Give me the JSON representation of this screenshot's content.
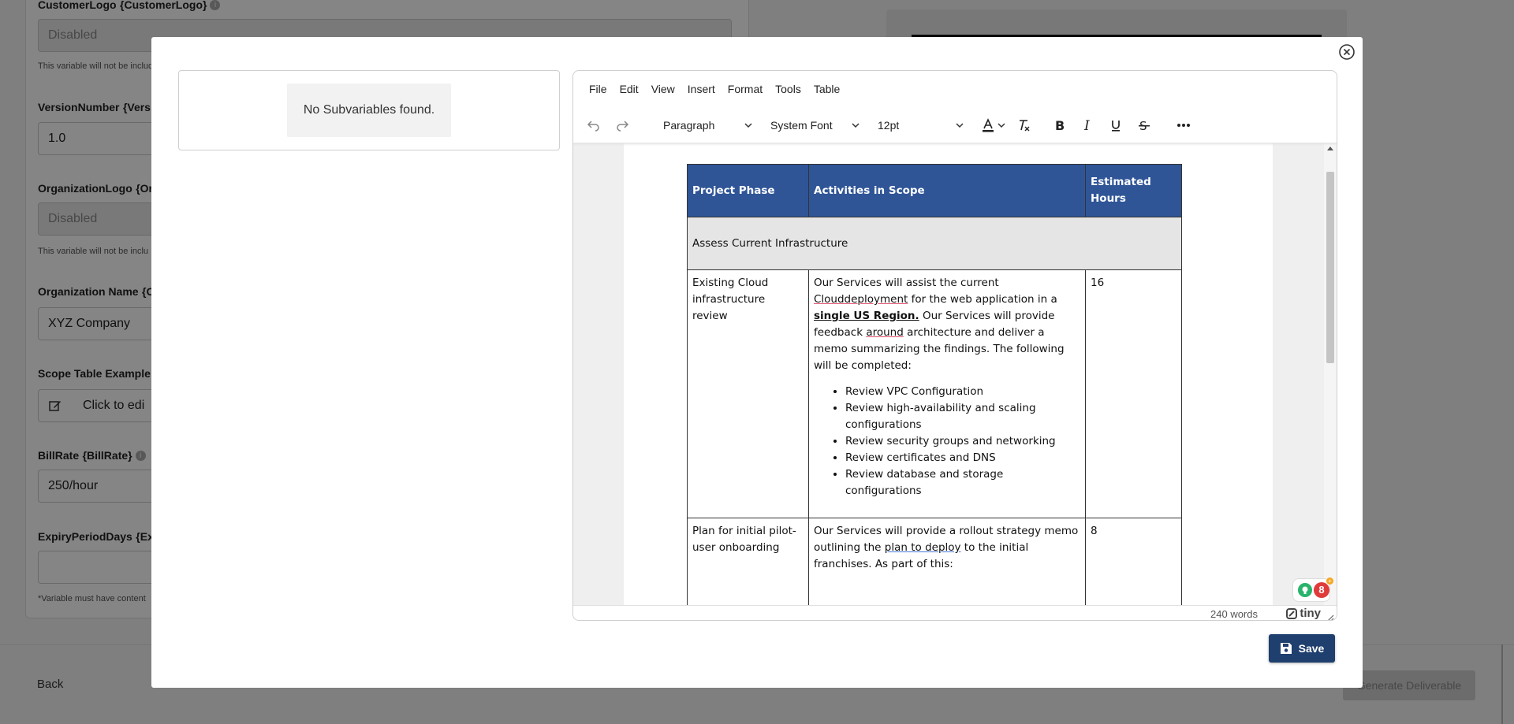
{
  "background": {
    "fields": [
      {
        "label": "CustomerLogo",
        "var": "{CustomerLogo}",
        "value": "Disabled",
        "hint": "This variable will not be included"
      },
      {
        "label": "VersionNumber",
        "var": "{Versio",
        "value": "1.0"
      },
      {
        "label": "OrganizationLogo",
        "var": "{Org",
        "value": "Disabled",
        "hint": "This variable will not be inclu"
      },
      {
        "label": "Organization Name",
        "var": "{Or",
        "value": "XYZ Company"
      },
      {
        "label": "Scope Table Example",
        "var": "{",
        "value": "Click to edi"
      },
      {
        "label": "BillRate",
        "var": "{BillRate}",
        "value": "250/hour"
      },
      {
        "label": "ExpiryPeriodDays",
        "var": "{Ex",
        "value": ""
      }
    ],
    "footnote": "*Variable must have content",
    "back_label": "Back",
    "generate_label": "Generate Deliverable"
  },
  "subvariables": {
    "empty_message": "No Subvariables found."
  },
  "editor": {
    "menu": [
      "File",
      "Edit",
      "View",
      "Insert",
      "Format",
      "Tools",
      "Table"
    ],
    "toolbar": {
      "block_format": "Paragraph",
      "font_family": "System Font",
      "font_size": "12pt"
    },
    "table": {
      "headers": [
        "Project Phase",
        "Activities in Scope",
        "Estimated Hours"
      ],
      "phase_title": "Assess Current Infrastructure",
      "rows": [
        {
          "phase": "Existing Cloud infrastructure review",
          "intro_1": "Our Services will assist the current ",
          "intro_spell": "Clouddeployment",
          "intro_2": " for the web application in a ",
          "intro_bold": "single US Region.",
          "intro_3": " Our Services will provide feedback ",
          "intro_spell2": "around",
          "intro_4": " architecture and deliver a memo summarizing the findings. The following will be completed:",
          "bullets": [
            "Review VPC Configuration",
            "Review high-availability and scaling configurations",
            "Review security groups and networking",
            "Review certificates and DNS",
            "Review database and storage configurations"
          ],
          "hours": "16"
        },
        {
          "phase": "Plan for initial pilot-user onboarding",
          "text_1": "Our Services will provide a rollout strategy memo outlining the ",
          "text_grammar": "plan to deploy",
          "text_2": " to the initial franchises. As part of this:",
          "hours": "8"
        }
      ]
    },
    "word_count": "240 words",
    "brand": "tiny",
    "suggestion_count": "8"
  },
  "actions": {
    "save_label": "Save"
  }
}
